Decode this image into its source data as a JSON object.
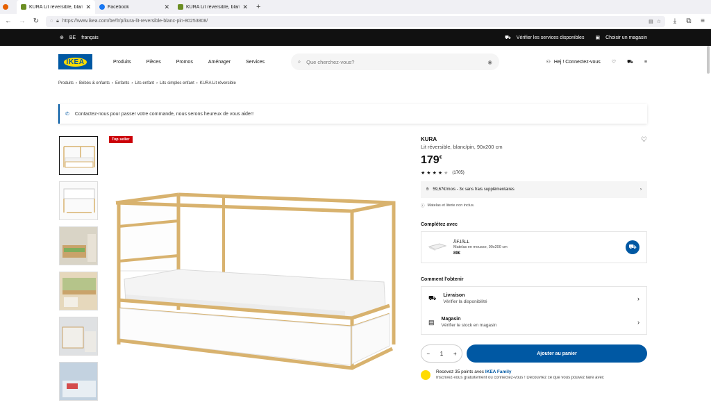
{
  "browser": {
    "tabs": [
      {
        "title": "KURA Lit réversible, blanc/pin",
        "color": "#6b8e23"
      },
      {
        "title": "Facebook",
        "color": "#1877f2"
      },
      {
        "title": "KURA Lit réversible, blanc/pin",
        "color": "#6b8e23"
      }
    ],
    "url": "https://www.ikea.com/be/fr/p/kura-lit-reversible-blanc-pin-80253808/"
  },
  "topstrip": {
    "country": "BE",
    "language": "français",
    "services": "Vérifier les services disponibles",
    "store": "Choisir un magasin"
  },
  "header": {
    "logo": "IKEA",
    "nav": [
      "Produits",
      "Pièces",
      "Promos",
      "Aménager",
      "Services"
    ],
    "search_placeholder": "Que cherchez-vous?",
    "login": "Hej ! Connectez-vous"
  },
  "breadcrumb": [
    "Produits",
    "Bébés & enfants",
    "Enfants",
    "Lits enfant",
    "Lits simples enfant",
    "KURA Lit réversible"
  ],
  "notice": "Contactez-nous pour passer votre commande, nous serons heureux de vous aider!",
  "product": {
    "badge": "Top seller",
    "name": "KURA",
    "description": "Lit réversible, blanc/pin, 90x200 cm",
    "price": "179",
    "currency": "€",
    "rating": 4.5,
    "reviews": "(1705)",
    "finance": "59,67€/mois - 3x sans frais supplémentaires",
    "note": "Matelas et literie non inclus."
  },
  "complete": {
    "heading": "Complétez avec",
    "item_name": "ÅFJÄLL",
    "item_desc": "Matelas en mousse, 90x200 cm",
    "item_price": "89€"
  },
  "obtain": {
    "heading": "Comment l'obtenir",
    "rows": [
      {
        "title": "Livraison",
        "sub": "Vérifier la disponibilité"
      },
      {
        "title": "Magasin",
        "sub": "Vérifier le stock en magasin"
      }
    ]
  },
  "buy": {
    "qty": "1",
    "add_label": "Ajouter au panier"
  },
  "family": {
    "text_a": "Recevez 35 points avec ",
    "text_b": "IKEA Family",
    "sub": "Inscrivez-vous gratuitement ou connectez-vous ! Découvrez ce que vous pouvez faire avec"
  }
}
